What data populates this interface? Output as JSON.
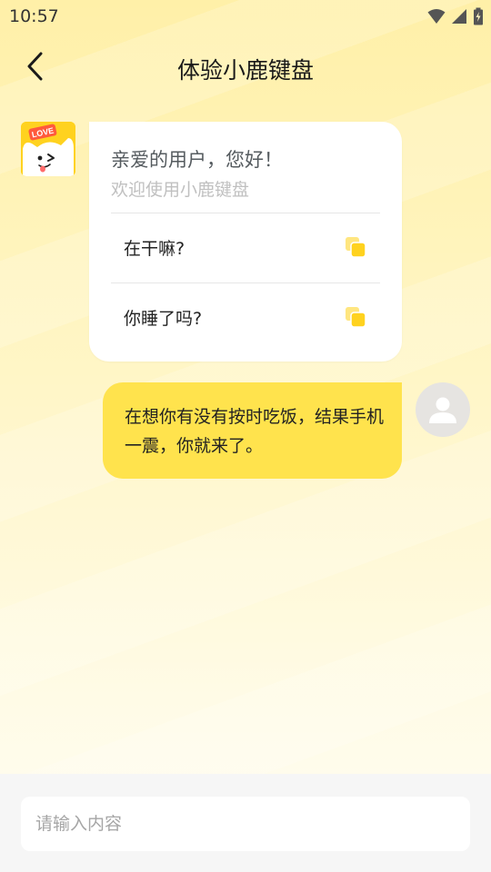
{
  "status_bar": {
    "time": "10:57"
  },
  "header": {
    "title": "体验小鹿键盘"
  },
  "bot": {
    "avatar_badge": "LOVE",
    "greeting": "亲爱的用户，您好！",
    "subtitle": "欢迎使用小鹿键盘",
    "questions": [
      {
        "text": "在干嘛?",
        "icon": "copy-icon"
      },
      {
        "text": "你睡了吗?",
        "icon": "copy-icon"
      }
    ]
  },
  "user_message": {
    "text": "在想你有没有按时吃饭，结果手机一震，你就来了。"
  },
  "input": {
    "placeholder": "请输入内容",
    "value": ""
  },
  "colors": {
    "accent": "#ffe34d",
    "icon_yellow": "#ffd21f",
    "background_top": "#fff0a8"
  }
}
